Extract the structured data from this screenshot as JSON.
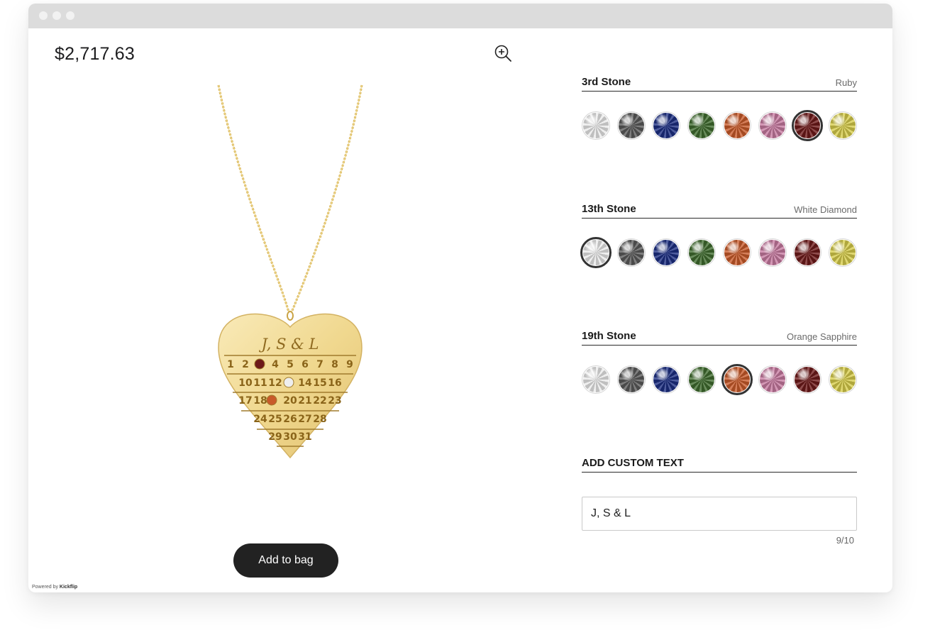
{
  "product": {
    "price": "$2,717.63",
    "engraving": "J, S & L",
    "calendar_rows": [
      [
        "1",
        "2",
        "",
        "4",
        "5",
        "6",
        "7",
        "8",
        "9"
      ],
      [
        "10",
        "11",
        "12",
        "",
        "14",
        "15",
        "16"
      ],
      [
        "17",
        "18",
        "",
        "20",
        "21",
        "22",
        "23"
      ],
      [
        "24",
        "25",
        "26",
        "27",
        "28"
      ],
      [
        "29",
        "30",
        "31"
      ]
    ]
  },
  "icons": {
    "zoom": "zoom-in-icon"
  },
  "stone_palette": [
    {
      "name": "white",
      "color": "#e9e9e9"
    },
    {
      "name": "black",
      "color": "#5a5a5a"
    },
    {
      "name": "blue",
      "color": "#1c2e82"
    },
    {
      "name": "green",
      "color": "#3f6b2e"
    },
    {
      "name": "orange",
      "color": "#c85a2a"
    },
    {
      "name": "pink",
      "color": "#c77aa0"
    },
    {
      "name": "ruby",
      "color": "#6e1a1a"
    },
    {
      "name": "yellow",
      "color": "#d6cc4a"
    }
  ],
  "sections": {
    "stone_3": {
      "title": "3rd Stone",
      "value": "Ruby",
      "selected_index": 6
    },
    "stone_13": {
      "title": "13th Stone",
      "value": "White Diamond",
      "selected_index": 0
    },
    "stone_19": {
      "title": "19th Stone",
      "value": "Orange Sapphire",
      "selected_index": 4
    },
    "custom_text": {
      "title": "ADD CUSTOM TEXT",
      "value": "J, S & L",
      "counter": "9/10"
    }
  },
  "actions": {
    "add_to_bag": "Add to bag"
  },
  "footer": {
    "powered_prefix": "Powered by",
    "powered_brand": "Kickflip"
  }
}
